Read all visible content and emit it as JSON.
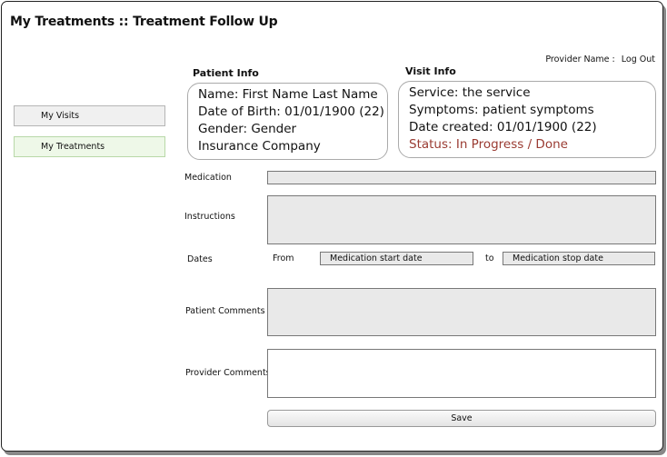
{
  "header": {
    "title": "My Treatments :: Treatment Follow Up",
    "provider_label": "Provider Name :",
    "logout_label": "Log Out"
  },
  "sidebar": {
    "items": [
      {
        "label": "My Visits"
      },
      {
        "label": "My Treatments"
      }
    ]
  },
  "patient_info": {
    "heading": "Patient Info",
    "name": "Name: First Name Last Name",
    "dob": "Date of Birth: 01/01/1900 (22)",
    "gender": "Gender: Gender",
    "insurance": "Insurance Company"
  },
  "visit_info": {
    "heading": "Visit Info",
    "service": "Service: the service",
    "symptoms": "Symptoms: patient symptoms",
    "date_created": "Date created: 01/01/1900 (22)",
    "status": "Status: In Progress / Done"
  },
  "form": {
    "medication_label": "Medication",
    "instructions_label": "Instructions",
    "dates_label": "Dates",
    "from_label": "From",
    "start_date_placeholder": "Medication start date",
    "to_label": "to",
    "stop_date_placeholder": "Medication stop date",
    "patient_comments_label": "Patient Comments",
    "provider_comments_label": "Provider Comments",
    "save_label": "Save"
  },
  "colors": {
    "status": "#9a3b32",
    "active_nav_bg": "#eef8e8"
  }
}
